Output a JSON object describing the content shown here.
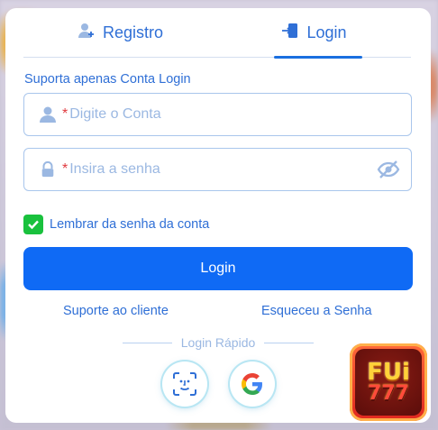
{
  "tabs": [
    {
      "label": "Registro",
      "icon": "user-add-icon",
      "active": false
    },
    {
      "label": "Login",
      "icon": "login-door-icon",
      "active": true
    }
  ],
  "form": {
    "hint": "Suporta apenas Conta Login",
    "account_placeholder": "Digite o Conta",
    "password_placeholder": "Insira a senha",
    "required_mark": "*",
    "remember_label": "Lembrar da senha da conta",
    "remember_checked": true,
    "login_button": "Login"
  },
  "links": {
    "support": "Suporte ao cliente",
    "forgot": "Esqueceu a Senha"
  },
  "quick_login": {
    "label": "Login Rápido",
    "methods": [
      "face-id-icon",
      "google-icon"
    ]
  },
  "brand": {
    "logo_word": "FUi",
    "logo_number": "777"
  },
  "colors": {
    "accent": "#0f6af5",
    "link": "#2f6fd6",
    "checkbox": "#19c13d",
    "required": "#e0393e",
    "placeholder": "#9bb8e2"
  }
}
